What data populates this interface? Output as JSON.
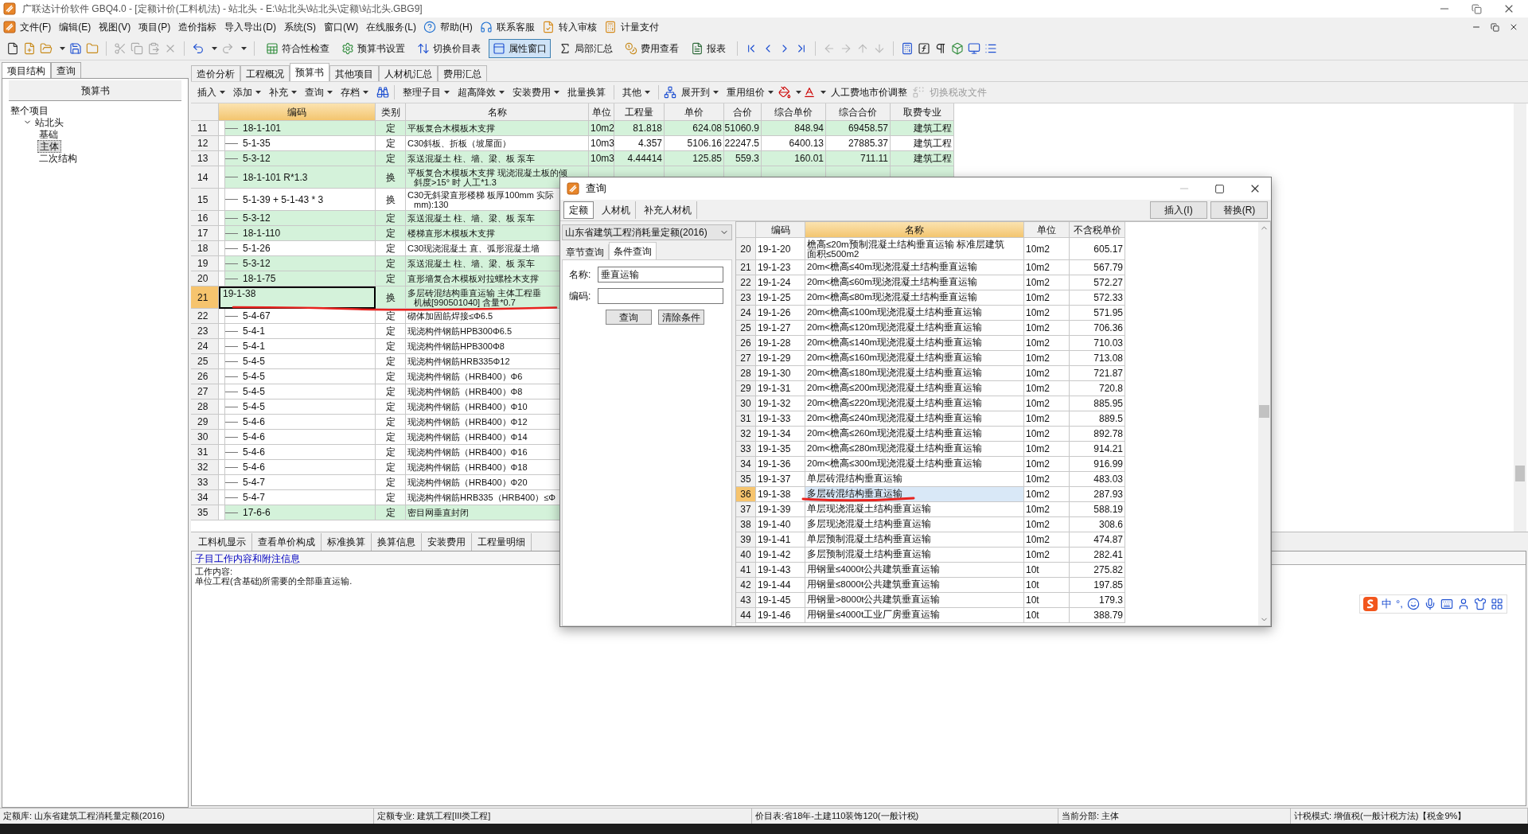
{
  "window": {
    "title": "广联达计价软件 GBQ4.0 - [定额计价(工料机法) - 站北头 - E:\\站北头\\站北头\\定额\\站北头.GBG9]"
  },
  "menu": [
    "文件(F)",
    "编辑(E)",
    "视图(V)",
    "项目(P)",
    "造价指标",
    "导入导出(D)",
    "系统(S)",
    "窗口(W)",
    "在线服务(L)",
    "帮助(H)",
    "联系客服",
    "转入审核",
    "计量支付"
  ],
  "toolbar": [
    {
      "label": "符合性检查",
      "pressed": false
    },
    {
      "label": "预算书设置",
      "pressed": false
    },
    {
      "label": "切换价目表",
      "pressed": false
    },
    {
      "label": "属性窗口",
      "pressed": true
    },
    {
      "label": "局部汇总",
      "pressed": false
    },
    {
      "label": "费用查看",
      "pressed": false
    },
    {
      "label": "报表",
      "pressed": false
    }
  ],
  "left_panel": {
    "tabs": [
      {
        "label": "项目结构",
        "selected": true
      },
      {
        "label": "查询",
        "selected": false
      }
    ],
    "header": "预算书",
    "tree": [
      {
        "label": "整个项目",
        "selected": false,
        "children": [
          {
            "label": "站北头",
            "selected": false,
            "expanded": true,
            "children": [
              {
                "label": "基础",
                "selected": false
              },
              {
                "label": "主体",
                "selected": true
              },
              {
                "label": "二次结构",
                "selected": false
              }
            ]
          }
        ]
      }
    ]
  },
  "doc_tabs": [
    {
      "label": "造价分析",
      "selected": false
    },
    {
      "label": "工程概况",
      "selected": false
    },
    {
      "label": "预算书",
      "selected": true
    },
    {
      "label": "其他项目",
      "selected": false
    },
    {
      "label": "人材机汇总",
      "selected": false
    },
    {
      "label": "费用汇总",
      "selected": false
    }
  ],
  "doc_toolbar": [
    [
      {
        "label": "插入",
        "dropdown": true,
        "disabled": false
      },
      {
        "label": "添加",
        "dropdown": true,
        "disabled": false
      },
      {
        "label": "补充",
        "dropdown": true,
        "disabled": false
      },
      {
        "label": "查询",
        "dropdown": true,
        "disabled": false
      },
      {
        "label": "存档",
        "dropdown": true,
        "disabled": false
      }
    ],
    [
      {
        "label": "整理子目",
        "dropdown": true,
        "disabled": false
      },
      {
        "label": "超高降效",
        "dropdown": true,
        "disabled": false
      },
      {
        "label": "安装费用",
        "dropdown": true,
        "disabled": false
      },
      {
        "label": "批量换算",
        "dropdown": false,
        "disabled": false
      }
    ],
    [
      {
        "label": "其他",
        "dropdown": true,
        "disabled": false
      }
    ],
    [
      {
        "label": "展开到",
        "dropdown": true,
        "disabled": false
      },
      {
        "label": "重用组价",
        "dropdown": true,
        "disabled": false
      },
      {
        "label": "人工费地市价调整",
        "dropdown": false,
        "disabled": false
      },
      {
        "label": "切换税改文件",
        "dropdown": false,
        "disabled": true
      }
    ]
  ],
  "table": {
    "columns": [
      {
        "label": "编码",
        "highlighted": true
      },
      {
        "label": "类别",
        "highlighted": false
      },
      {
        "label": "名称",
        "highlighted": false
      },
      {
        "label": "单位",
        "highlighted": false
      },
      {
        "label": "工程量",
        "highlighted": false
      },
      {
        "label": "单价",
        "highlighted": false
      },
      {
        "label": "合价",
        "highlighted": false
      },
      {
        "label": "综合单价",
        "highlighted": false
      },
      {
        "label": "综合合价",
        "highlighted": false
      },
      {
        "label": "取费专业",
        "highlighted": false
      }
    ],
    "rows": [
      {
        "no": "11",
        "code": "18-1-101",
        "type": "定",
        "name": "平板复合木模板木支撑",
        "unit": "10m2",
        "qty": "81.818",
        "price": "624.08",
        "total": "51060.9",
        "unit_total": "848.94",
        "sum_total": "69458.57",
        "category": "建筑工程",
        "shaded": true,
        "selected": false
      },
      {
        "no": "12",
        "code": "5-1-35",
        "type": "定",
        "name": "C30斜板、折板（坡屋面）",
        "unit": "10m3",
        "qty": "4.357",
        "price": "5106.16",
        "total": "22247.5",
        "unit_total": "6400.13",
        "sum_total": "27885.37",
        "category": "建筑工程",
        "shaded": false,
        "selected": false
      },
      {
        "no": "13",
        "code": "5-3-12",
        "type": "定",
        "name": "泵送混凝土 柱、墙、梁、板 泵车",
        "unit": "10m3",
        "qty": "4.44414",
        "price": "125.85",
        "total": "559.3",
        "unit_total": "160.01",
        "sum_total": "711.11",
        "category": "建筑工程",
        "shaded": true,
        "selected": false
      },
      {
        "no": "14",
        "code": "18-1-101 R*1.3",
        "type": "换",
        "name": [
          "平板复合木模板木支撑 现浇混凝土板的倾",
          "斜度>15° 时 人工*1.3"
        ],
        "shaded": true,
        "selected": false
      },
      {
        "no": "15",
        "code": "5-1-39 + 5-1-43 * 3",
        "type": "换",
        "name": [
          "C30无斜梁直形楼梯 板厚100mm 实际",
          "mm):130"
        ],
        "shaded": false,
        "selected": false
      },
      {
        "no": "16",
        "code": "5-3-12",
        "type": "定",
        "name": "泵送混凝土 柱、墙、梁、板 泵车",
        "shaded": true,
        "selected": false
      },
      {
        "no": "17",
        "code": "18-1-110",
        "type": "定",
        "name": "楼梯直形木模板木支撑",
        "shaded": true,
        "selected": false
      },
      {
        "no": "18",
        "code": "5-1-26",
        "type": "定",
        "name": "C30现浇混凝土 直、弧形混凝土墙",
        "shaded": false,
        "selected": false
      },
      {
        "no": "19",
        "code": "5-3-12",
        "type": "定",
        "name": "泵送混凝土 柱、墙、梁、板 泵车",
        "shaded": true,
        "selected": false
      },
      {
        "no": "20",
        "code": "18-1-75",
        "type": "定",
        "name": "直形墙复合木模板对拉螺栓木支撑",
        "shaded": true,
        "selected": false
      },
      {
        "no": "21",
        "code": "19-1-38",
        "type": "换",
        "name": [
          "多层砖混结构垂直运输 主体工程垂",
          "机械[990501040] 含量*0.7"
        ],
        "shaded": true,
        "selected": true
      },
      {
        "no": "22",
        "code": "5-4-67",
        "type": "定",
        "name": "砌体加固筋焊接≤Φ6.5",
        "shaded": false,
        "selected": false
      },
      {
        "no": "23",
        "code": "5-4-1",
        "type": "定",
        "name": "现浇构件钢筋HPB300Φ6.5",
        "shaded": false,
        "selected": false
      },
      {
        "no": "24",
        "code": "5-4-1",
        "type": "定",
        "name": "现浇构件钢筋HPB300Φ8",
        "shaded": false,
        "selected": false
      },
      {
        "no": "25",
        "code": "5-4-5",
        "type": "定",
        "name": "现浇构件钢筋HRB335Φ12",
        "shaded": false,
        "selected": false
      },
      {
        "no": "26",
        "code": "5-4-5",
        "type": "定",
        "name": "现浇构件钢筋（HRB400）Φ6",
        "shaded": false,
        "selected": false
      },
      {
        "no": "27",
        "code": "5-4-5",
        "type": "定",
        "name": "现浇构件钢筋（HRB400）Φ8",
        "shaded": false,
        "selected": false
      },
      {
        "no": "28",
        "code": "5-4-5",
        "type": "定",
        "name": "现浇构件钢筋（HRB400）Φ10",
        "shaded": false,
        "selected": false
      },
      {
        "no": "29",
        "code": "5-4-6",
        "type": "定",
        "name": "现浇构件钢筋（HRB400）Φ12",
        "shaded": false,
        "selected": false
      },
      {
        "no": "30",
        "code": "5-4-6",
        "type": "定",
        "name": "现浇构件钢筋（HRB400）Φ14",
        "shaded": false,
        "selected": false
      },
      {
        "no": "31",
        "code": "5-4-6",
        "type": "定",
        "name": "现浇构件钢筋（HRB400）Φ16",
        "shaded": false,
        "selected": false
      },
      {
        "no": "32",
        "code": "5-4-6",
        "type": "定",
        "name": "现浇构件钢筋（HRB400）Φ18",
        "shaded": false,
        "selected": false
      },
      {
        "no": "33",
        "code": "5-4-7",
        "type": "定",
        "name": "现浇构件钢筋（HRB400）Φ20",
        "shaded": false,
        "selected": false
      },
      {
        "no": "34",
        "code": "5-4-7",
        "type": "定",
        "name": "现浇构件钢筋HRB335（HRB400）≤Φ",
        "shaded": false,
        "selected": false
      },
      {
        "no": "35",
        "code": "17-6-6",
        "type": "定",
        "name": "密目网垂直封闭",
        "shaded": true,
        "selected": false
      }
    ]
  },
  "bottom_tabs": [
    {
      "label": "工料机显示",
      "selected": false
    },
    {
      "label": "查看单价构成",
      "selected": false
    },
    {
      "label": "标准换算",
      "selected": false
    },
    {
      "label": "换算信息",
      "selected": false
    },
    {
      "label": "安装费用",
      "selected": false
    },
    {
      "label": "工程量明细",
      "selected": false
    }
  ],
  "info": {
    "title": "子目工作内容和附注信息",
    "lines": [
      "工作内容:",
      "单位工程(含基础)所需要的全部垂直运输."
    ]
  },
  "status_bar": [
    "定额库: 山东省建筑工程消耗量定额(2016)",
    "定额专业: 建筑工程[III类工程]",
    "价目表:省18年-土建110装饰120(一般计税)",
    "当前分部: 主体",
    "计税模式: 增值税(一般计税方法)【税金9%】"
  ],
  "ime": [
    "中",
    "°,"
  ],
  "dialog": {
    "title": "查询",
    "tabs": [
      {
        "label": "定额",
        "selected": true
      },
      {
        "label": "人材机",
        "selected": false
      },
      {
        "label": "补充人材机",
        "selected": false
      }
    ],
    "buttons": [
      "插入(I)",
      "替换(R)"
    ],
    "library": "山东省建筑工程消耗量定额(2016)",
    "subtabs": [
      {
        "label": "章节查询",
        "selected": false
      },
      {
        "label": "条件查询",
        "selected": true
      }
    ],
    "fields": [
      {
        "label": "名称:",
        "value": "垂直运输"
      },
      {
        "label": "编码:"
      }
    ],
    "actions": [
      "查询",
      "清除条件"
    ],
    "columns": [
      {
        "label": "编码",
        "highlighted": false
      },
      {
        "label": "名称",
        "highlighted": true
      },
      {
        "label": "单位",
        "highlighted": false
      },
      {
        "label": "不含税单价",
        "highlighted": false
      }
    ],
    "rows": [
      {
        "no": "20",
        "code": "19-1-20",
        "name": [
          "檐高≤20m预制混凝土结构垂直运输 标准层建筑",
          "面积≤500m2"
        ],
        "unit": "10m2",
        "price": "605.17",
        "selected": false
      },
      {
        "no": "21",
        "code": "19-1-23",
        "name": "20m<檐高≤40m现浇混凝土结构垂直运输",
        "unit": "10m2",
        "price": "567.79",
        "selected": false
      },
      {
        "no": "22",
        "code": "19-1-24",
        "name": "20m<檐高≤60m现浇混凝土结构垂直运输",
        "unit": "10m2",
        "price": "572.27",
        "selected": false
      },
      {
        "no": "23",
        "code": "19-1-25",
        "name": "20m<檐高≤80m现浇混凝土结构垂直运输",
        "unit": "10m2",
        "price": "572.33",
        "selected": false
      },
      {
        "no": "24",
        "code": "19-1-26",
        "name": "20m<檐高≤100m现浇混凝土结构垂直运输",
        "unit": "10m2",
        "price": "571.95",
        "selected": false
      },
      {
        "no": "25",
        "code": "19-1-27",
        "name": "20m<檐高≤120m现浇混凝土结构垂直运输",
        "unit": "10m2",
        "price": "706.36",
        "selected": false
      },
      {
        "no": "26",
        "code": "19-1-28",
        "name": "20m<檐高≤140m现浇混凝土结构垂直运输",
        "unit": "10m2",
        "price": "710.03",
        "selected": false
      },
      {
        "no": "27",
        "code": "19-1-29",
        "name": "20m<檐高≤160m现浇混凝土结构垂直运输",
        "unit": "10m2",
        "price": "713.08",
        "selected": false
      },
      {
        "no": "28",
        "code": "19-1-30",
        "name": "20m<檐高≤180m现浇混凝土结构垂直运输",
        "unit": "10m2",
        "price": "721.87",
        "selected": false
      },
      {
        "no": "29",
        "code": "19-1-31",
        "name": "20m<檐高≤200m现浇混凝土结构垂直运输",
        "unit": "10m2",
        "price": "720.8",
        "selected": false
      },
      {
        "no": "30",
        "code": "19-1-32",
        "name": "20m<檐高≤220m现浇混凝土结构垂直运输",
        "unit": "10m2",
        "price": "885.95",
        "selected": false
      },
      {
        "no": "31",
        "code": "19-1-33",
        "name": "20m<檐高≤240m现浇混凝土结构垂直运输",
        "unit": "10m2",
        "price": "889.5",
        "selected": false
      },
      {
        "no": "32",
        "code": "19-1-34",
        "name": "20m<檐高≤260m现浇混凝土结构垂直运输",
        "unit": "10m2",
        "price": "892.78",
        "selected": false
      },
      {
        "no": "33",
        "code": "19-1-35",
        "name": "20m<檐高≤280m现浇混凝土结构垂直运输",
        "unit": "10m2",
        "price": "914.21",
        "selected": false
      },
      {
        "no": "34",
        "code": "19-1-36",
        "name": "20m<檐高≤300m现浇混凝土结构垂直运输",
        "unit": "10m2",
        "price": "916.99",
        "selected": false
      },
      {
        "no": "35",
        "code": "19-1-37",
        "name": "单层砖混结构垂直运输",
        "unit": "10m2",
        "price": "483.03",
        "selected": false
      },
      {
        "no": "36",
        "code": "19-1-38",
        "name": "多层砖混结构垂直运输",
        "unit": "10m2",
        "price": "287.93",
        "selected": true
      },
      {
        "no": "37",
        "code": "19-1-39",
        "name": "单层现浇混凝土结构垂直运输",
        "unit": "10m2",
        "price": "588.19",
        "selected": false
      },
      {
        "no": "38",
        "code": "19-1-40",
        "name": "多层现浇混凝土结构垂直运输",
        "unit": "10m2",
        "price": "308.6",
        "selected": false
      },
      {
        "no": "39",
        "code": "19-1-41",
        "name": "单层预制混凝土结构垂直运输",
        "unit": "10m2",
        "price": "474.87",
        "selected": false
      },
      {
        "no": "40",
        "code": "19-1-42",
        "name": "多层预制混凝土结构垂直运输",
        "unit": "10m2",
        "price": "282.41",
        "selected": false
      },
      {
        "no": "41",
        "code": "19-1-43",
        "name": "用钢量≤4000t公共建筑垂直运输",
        "unit": "10t",
        "price": "275.82",
        "selected": false
      },
      {
        "no": "42",
        "code": "19-1-44",
        "name": "用钢量≤8000t公共建筑垂直运输",
        "unit": "10t",
        "price": "197.85",
        "selected": false
      },
      {
        "no": "43",
        "code": "19-1-45",
        "name": "用钢量>8000t公共建筑垂直运输",
        "unit": "10t",
        "price": "179.3",
        "selected": false
      },
      {
        "no": "44",
        "code": "19-1-46",
        "name": "用钢量≤4000t工业厂房垂直运输",
        "unit": "10t",
        "price": "388.79",
        "selected": false
      }
    ]
  }
}
